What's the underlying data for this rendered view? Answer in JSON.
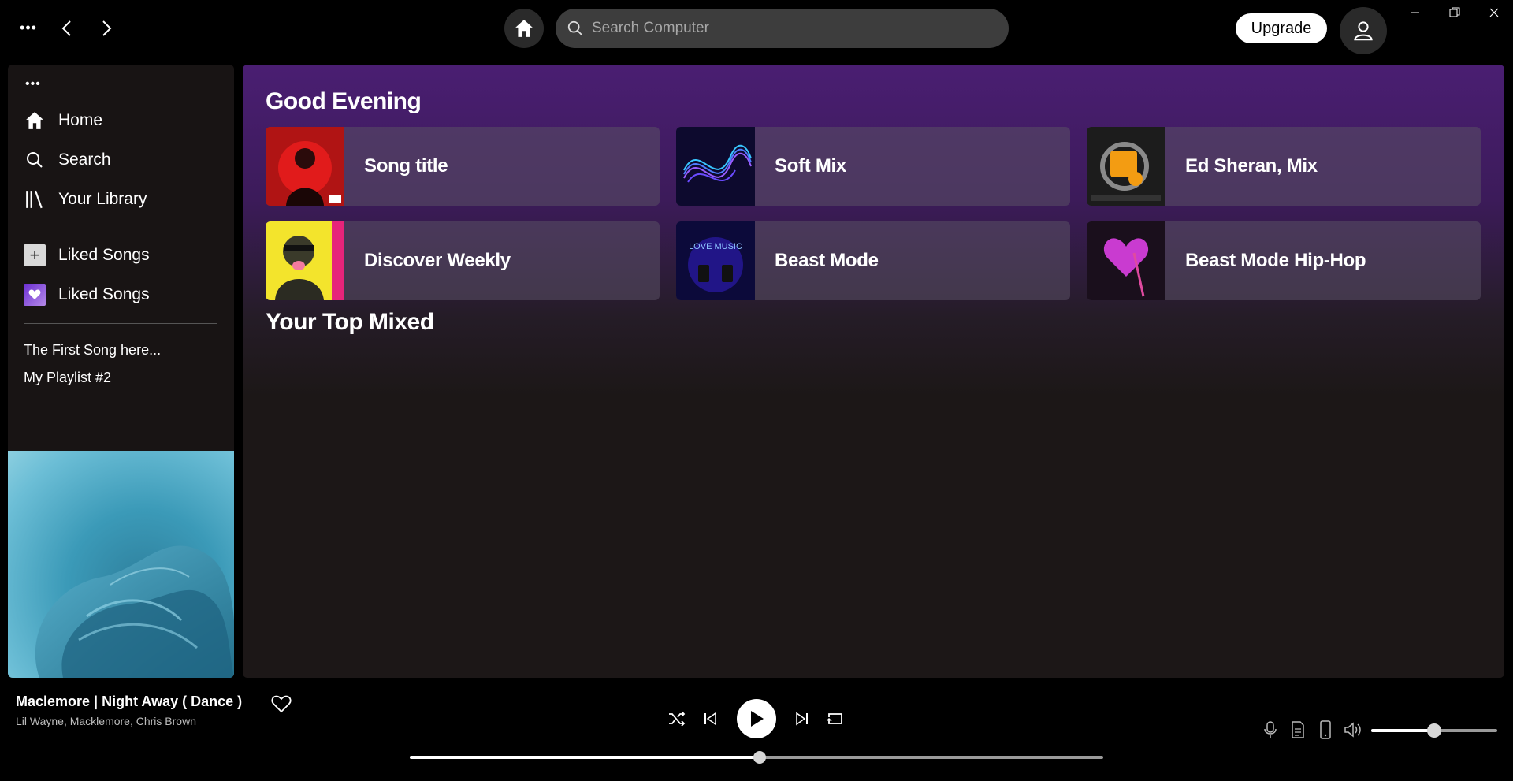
{
  "topbar": {
    "more_icon": "more-dots-icon",
    "back_icon": "chevron-left-icon",
    "forward_icon": "chevron-right-icon",
    "home_icon": "home-icon",
    "search": {
      "placeholder": "Search Computer",
      "value": ""
    },
    "upgrade_label": "Upgrade",
    "avatar_icon": "user-icon",
    "window_controls": [
      "minimize-icon",
      "restore-icon",
      "close-icon"
    ]
  },
  "sidebar": {
    "nav": [
      {
        "label": "Home",
        "icon": "home-icon"
      },
      {
        "label": "Search",
        "icon": "search-icon"
      },
      {
        "label": "Your Library",
        "icon": "library-icon"
      }
    ],
    "actions": [
      {
        "label": "Liked Songs",
        "icon": "plus-icon"
      },
      {
        "label": "Liked Songs",
        "icon": "heart-icon"
      }
    ],
    "playlists": [
      "The First Song here...",
      "My Playlist #2"
    ],
    "album_art": "now-playing-album-art"
  },
  "main": {
    "greeting": "Good Evening",
    "cards": [
      {
        "title": "Song title",
        "cover": "red-portrait-cover"
      },
      {
        "title": "Soft Mix",
        "cover": "blue-wave-cover"
      },
      {
        "title": "Ed Sheran, Mix",
        "cover": "one-day-cover"
      },
      {
        "title": "Discover Weekly",
        "cover": "yellow-portrait-cover"
      },
      {
        "title": "Beast Mode",
        "cover": "love-music-cover"
      },
      {
        "title": "Beast Mode Hip-Hop",
        "cover": "pink-heart-cover"
      }
    ],
    "section_title": "Your Top Mixed"
  },
  "player": {
    "track_title": "Maclemore | Night Away ( Dance )",
    "artists": "Lil Wayne, Macklemore, Chris Brown",
    "progress_fraction": 0.505,
    "volume_fraction": 0.5,
    "controls": [
      "shuffle-icon",
      "previous-icon",
      "play-icon",
      "next-icon",
      "repeat-icon"
    ],
    "devices": [
      "microphone-icon",
      "queue-icon",
      "device-icon",
      "volume-icon"
    ]
  },
  "colors": {
    "accent_purple": "#4a1e72",
    "background": "#000000",
    "panel": "#181414"
  }
}
